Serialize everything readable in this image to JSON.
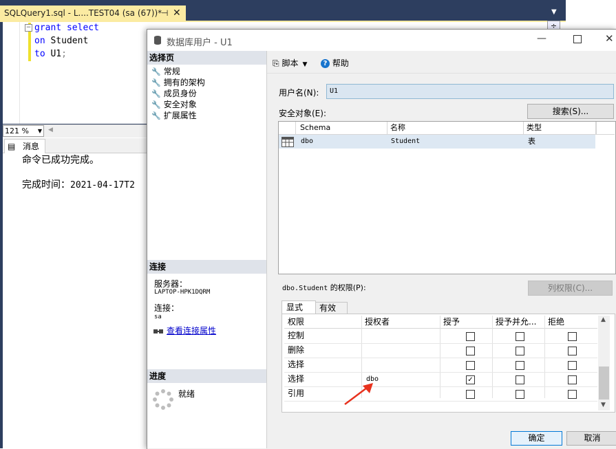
{
  "ssms": {
    "tab_title": "SQLQuery1.sql - L....TEST04 (sa (67))*",
    "tab_pin": "⊣",
    "tab_close": "✕",
    "code": {
      "line1_kw": "grant select",
      "line2_kw": "on",
      "line2_rest": " Student",
      "line3_kw": "to",
      "line3_rest": " U1",
      "line3_semi": ";"
    },
    "zoom": "121 %",
    "messages_tab": "消息",
    "message_line1": "命令已成功完成。",
    "message_line2_label": "完成时间：",
    "message_line2_value": "2021-04-17T2"
  },
  "dialog": {
    "title": "数据库用户 - U1",
    "left": {
      "select_page_header": "选择页",
      "nav_items": [
        "常规",
        "拥有的架构",
        "成员身份",
        "安全对象",
        "扩展属性"
      ],
      "connection_header": "连接",
      "server_label": "服务器：",
      "server_value": "LAPTOP-HPK1DQRM",
      "connection_label": "连接：",
      "connection_value": "sa",
      "view_connection_properties": "查看连接属性",
      "progress_header": "进度",
      "progress_status": "就绪"
    },
    "toolbar": {
      "script_label": "脚本",
      "help_label": "帮助"
    },
    "user_name_label": "用户名(N):",
    "user_name_value": "U1",
    "securables_label": "安全对象(E):",
    "search_button": "搜索(S)...",
    "securables_grid": {
      "columns": [
        "Schema",
        "名称",
        "类型"
      ],
      "rows": [
        {
          "schema": "dbo",
          "name": "Student",
          "type": "表"
        }
      ]
    },
    "permissions_label_obj": "dbo.Student",
    "permissions_label_suffix": " 的权限(P):",
    "column_permissions_button": "列权限(C)...",
    "perm_tabs": [
      "显式",
      "有效"
    ],
    "permissions_grid": {
      "columns": [
        "权限",
        "授权者",
        "授予",
        "授予并允...",
        "拒绝"
      ],
      "rows": [
        {
          "permission": "控制",
          "grantor": "",
          "grant": false,
          "with_grant": false,
          "deny": false
        },
        {
          "permission": "删除",
          "grantor": "",
          "grant": false,
          "with_grant": false,
          "deny": false
        },
        {
          "permission": "选择",
          "grantor": "",
          "grant": false,
          "with_grant": false,
          "deny": false
        },
        {
          "permission": "选择",
          "grantor": "dbo",
          "grant": true,
          "with_grant": false,
          "deny": false
        },
        {
          "permission": "引用",
          "grantor": "",
          "grant": false,
          "with_grant": false,
          "deny": false
        }
      ]
    },
    "ok_button": "确定",
    "cancel_button": "取消"
  },
  "colors": {
    "ssms_background": "#2d3e5f",
    "active_tab": "#fbeba2",
    "keyword": "#0000ff",
    "selected_row": "#dde8f3",
    "annotation_arrow": "#e8321e"
  }
}
